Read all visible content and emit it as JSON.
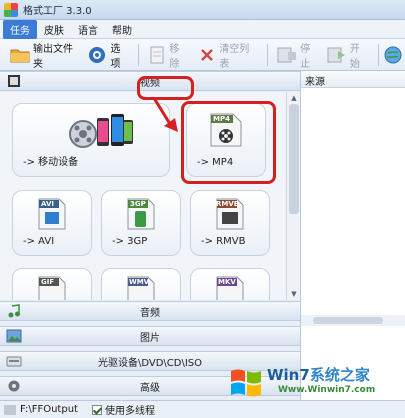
{
  "window": {
    "title": "格式工厂 3.3.0"
  },
  "menu": [
    "任务",
    "皮肤",
    "语言",
    "帮助"
  ],
  "toolbar": {
    "output_folder": "输出文件夹",
    "options": "选项",
    "remove": "移除",
    "clear_list": "清空列表",
    "stop": "停止",
    "start": "开始"
  },
  "categories": {
    "video": "视频",
    "audio": "音频",
    "image": "图片",
    "disc": "光驱设备\\DVD\\CD\\ISO",
    "advanced": "高级"
  },
  "video_tiles": [
    {
      "label": "-> 移动设备",
      "badge": ""
    },
    {
      "label": "-> MP4",
      "badge": "MP4"
    },
    {
      "label": "-> AVI",
      "badge": "AVI"
    },
    {
      "label": "-> 3GP",
      "badge": "3GP"
    },
    {
      "label": "-> RMVB",
      "badge": "RMVB"
    },
    {
      "label": "",
      "badge": "GIF"
    },
    {
      "label": "",
      "badge": "WMV"
    },
    {
      "label": "",
      "badge": "MKV"
    }
  ],
  "right_panel": {
    "header": "来源"
  },
  "status": {
    "output_path": "F:\\FFOutput",
    "multithread": "使用多线程",
    "multithread_checked": true
  },
  "watermark": {
    "brand_prefix": "Win7",
    "brand_suffix": "系统之家",
    "url": "Www.Winwin7.com"
  },
  "colors": {
    "accent": "#3a7bd5",
    "highlight": "#d42020"
  }
}
